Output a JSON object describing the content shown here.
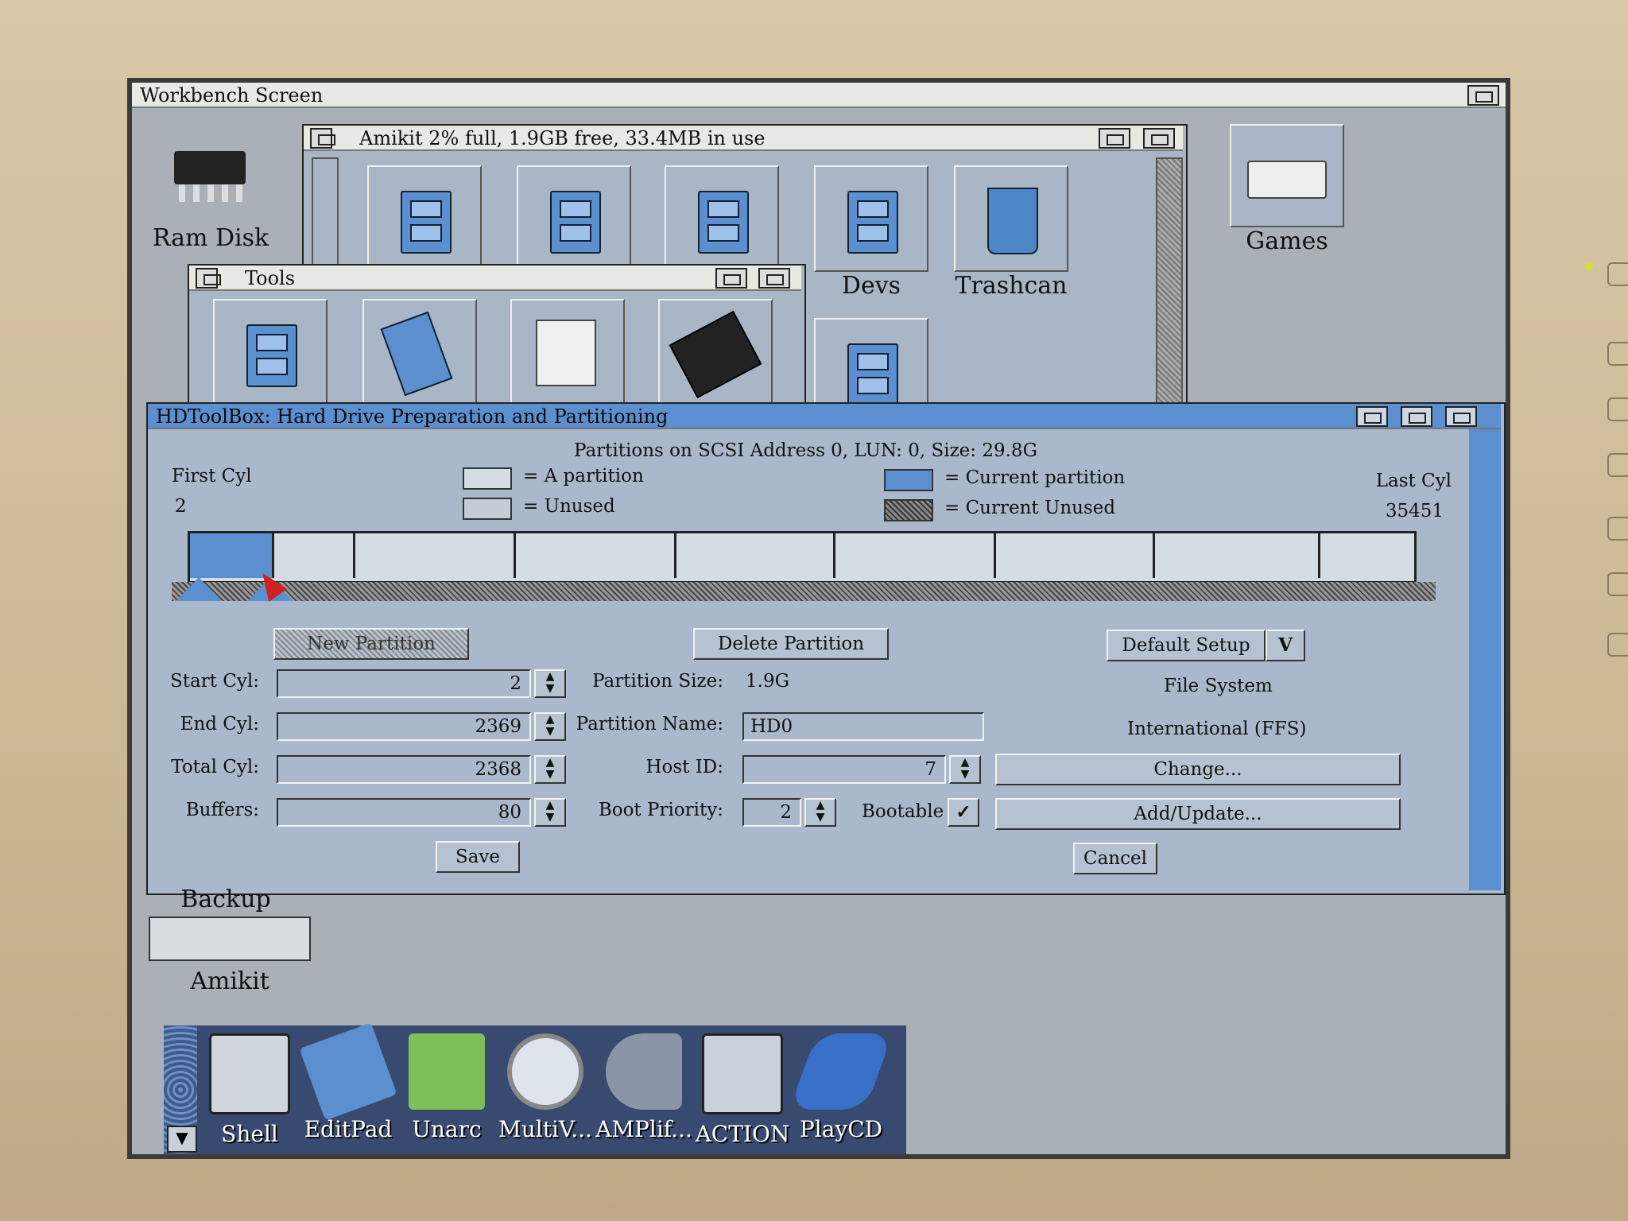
{
  "screen": {
    "title": "Workbench Screen"
  },
  "desktop_icons": [
    {
      "label": "Ram Disk"
    },
    {
      "label": "Games"
    },
    {
      "label": "Devs"
    },
    {
      "label": "Trashcan"
    },
    {
      "label": "Backup"
    },
    {
      "label": "Amikit"
    }
  ],
  "amikit_window": {
    "title": "Amikit 2% full, 1.9GB free, 33.4MB in use"
  },
  "tools_window": {
    "title": "Tools"
  },
  "hdtoolbox": {
    "title": "HDToolBox: Hard Drive Preparation and Partitioning",
    "partitions_heading": "Partitions on SCSI Address 0, LUN: 0, Size: 29.8G",
    "first_cyl_label": "First Cyl",
    "first_cyl_value": "2",
    "last_cyl_label": "Last Cyl",
    "last_cyl_value": "35451",
    "legend": {
      "a_partition": "= A partition",
      "unused": "= Unused",
      "current_partition": "= Current partition",
      "current_unused": "= Current Unused"
    },
    "buttons": {
      "new_partition": "New Partition",
      "delete_partition": "Delete Partition",
      "default_setup": "Default Setup",
      "default_setup_arrow": "V",
      "change": "Change...",
      "add_update": "Add/Update...",
      "save": "Save",
      "cancel": "Cancel"
    },
    "fields": {
      "start_cyl_label": "Start Cyl:",
      "start_cyl": "2",
      "end_cyl_label": "End Cyl:",
      "end_cyl": "2369",
      "total_cyl_label": "Total Cyl:",
      "total_cyl": "2368",
      "buffers_label": "Buffers:",
      "buffers": "80",
      "partition_size_label": "Partition Size:",
      "partition_size": "1.9G",
      "partition_name_label": "Partition Name:",
      "partition_name": "HD0",
      "host_id_label": "Host ID:",
      "host_id": "7",
      "boot_priority_label": "Boot Priority:",
      "boot_priority": "2",
      "bootable_label": "Bootable",
      "bootable_check": "✓"
    },
    "file_system_label": "File System",
    "file_system_value": "International (FFS)"
  },
  "dock": [
    {
      "label": "Shell"
    },
    {
      "label": "EditPad"
    },
    {
      "label": "Unarc"
    },
    {
      "label": "MultiV..."
    },
    {
      "label": "AMPlif..."
    },
    {
      "label": "ACTION"
    },
    {
      "label": "PlayCD"
    }
  ],
  "colors": {
    "current_partition": "#5b8fcf",
    "window_bg": "#a9b9cb",
    "titlebar_active": "#5b8fcf"
  }
}
